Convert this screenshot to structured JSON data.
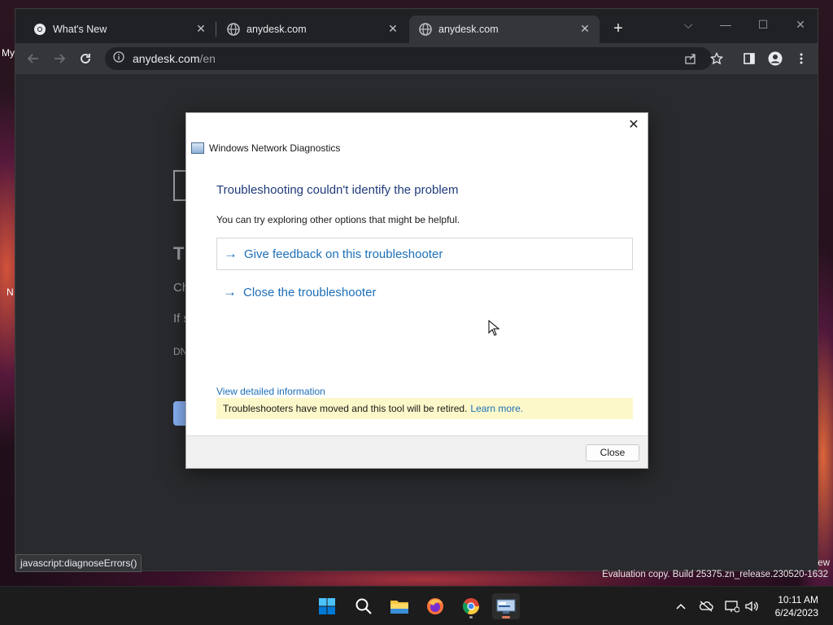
{
  "desktop": {
    "icon_labels": [
      "My",
      "N"
    ],
    "watermark": "Evaluation copy. Build 25375.zn_release.230520-1632",
    "watermark_tail": "ew"
  },
  "browser": {
    "tabs": [
      {
        "label": "What's New",
        "favicon": "chrome-icon",
        "active": false
      },
      {
        "label": "anydesk.com",
        "favicon": "globe-icon",
        "active": false
      },
      {
        "label": "anydesk.com",
        "favicon": "globe-icon",
        "active": true
      }
    ],
    "address": {
      "host": "anydesk.com",
      "path": "/en"
    },
    "status_bubble": "javascript:diagnoseErrors()",
    "page_fragments": {
      "heading": "Tl",
      "line1": "Ch",
      "line2": "If s",
      "code": "DN"
    }
  },
  "dialog": {
    "title": "Windows Network Diagnostics",
    "heading": "Troubleshooting couldn't identify the problem",
    "subtitle": "You can try exploring other options that might be helpful.",
    "options": [
      {
        "label": "Give feedback on this troubleshooter"
      },
      {
        "label": "Close the troubleshooter"
      }
    ],
    "detail_link": "View detailed information",
    "notice_text": "Troubleshooters have moved and this tool will be retired.",
    "notice_link": "Learn more.",
    "close_button": "Close"
  },
  "taskbar": {
    "apps": [
      "start-icon",
      "search-icon",
      "file-explorer-icon",
      "firefox-icon",
      "chrome-icon",
      "network-diagnostics-icon"
    ],
    "clock": {
      "time": "10:11 AM",
      "date": "6/24/2023"
    }
  },
  "colors": {
    "dialog_heading": "#1f3b78",
    "link": "#1d6fb8",
    "notice_bg": "#fdf8c9",
    "browser_frame": "#202124",
    "toolbar": "#35363a"
  }
}
